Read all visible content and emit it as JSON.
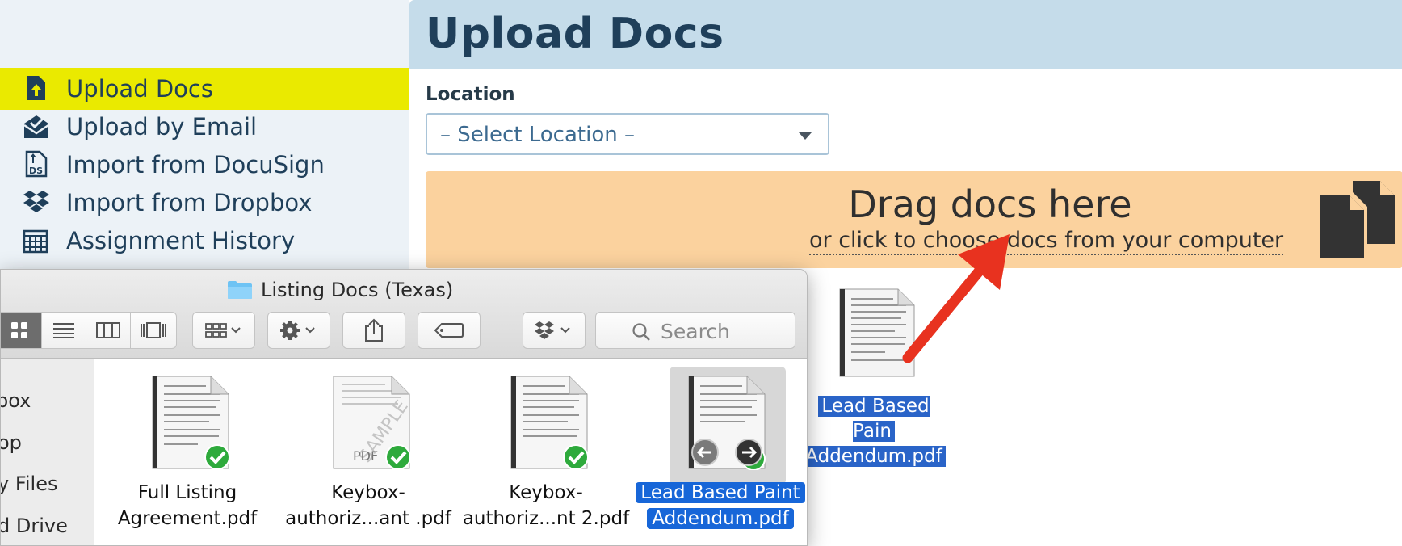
{
  "sidebar": {
    "items": [
      {
        "label": "Upload Docs",
        "icon": "upload-doc-icon",
        "active": true
      },
      {
        "label": "Upload by Email",
        "icon": "email-upload-icon"
      },
      {
        "label": "Import from DocuSign",
        "icon": "docusign-icon"
      },
      {
        "label": "Import from Dropbox",
        "icon": "dropbox-icon"
      },
      {
        "label": "Assignment History",
        "icon": "history-icon"
      }
    ],
    "active_color": "#eaea00"
  },
  "main": {
    "title": "Upload Docs",
    "location": {
      "label": "Location",
      "selected": "– Select Location –"
    },
    "dropzone": {
      "title": "Drag docs here",
      "subtitle": "or click to choose docs from your computer",
      "icon": "documents-icon",
      "color": "#fbd29e"
    }
  },
  "dragged_file": {
    "label_line1": "Lead Based Pain",
    "label_line2": "Addendum.pdf"
  },
  "finder": {
    "title": "Listing Docs (Texas)",
    "search_placeholder": "Search",
    "sidebar_items": [
      "box",
      "op",
      "y Files",
      "d Drive"
    ],
    "files": [
      {
        "line1": "Full Listing",
        "line2": "Agreement.pdf",
        "status": "synced"
      },
      {
        "line1": "Keybox-",
        "line2": "authoriz...ant .pdf",
        "status": "synced",
        "watermark": "SAMPLE",
        "badge": "PDF"
      },
      {
        "line1": "Keybox-",
        "line2": "authoriz...nt 2.pdf",
        "status": "synced"
      },
      {
        "line1": "Lead Based Paint",
        "line2": "Addendum.pdf",
        "status": "synced",
        "selected": true
      }
    ]
  },
  "colors": {
    "header_bg": "#c5dcea",
    "title_text": "#1f3f5a",
    "selection": "#1766d8",
    "arrow": "#e8321f",
    "check": "#2eaa3c"
  }
}
